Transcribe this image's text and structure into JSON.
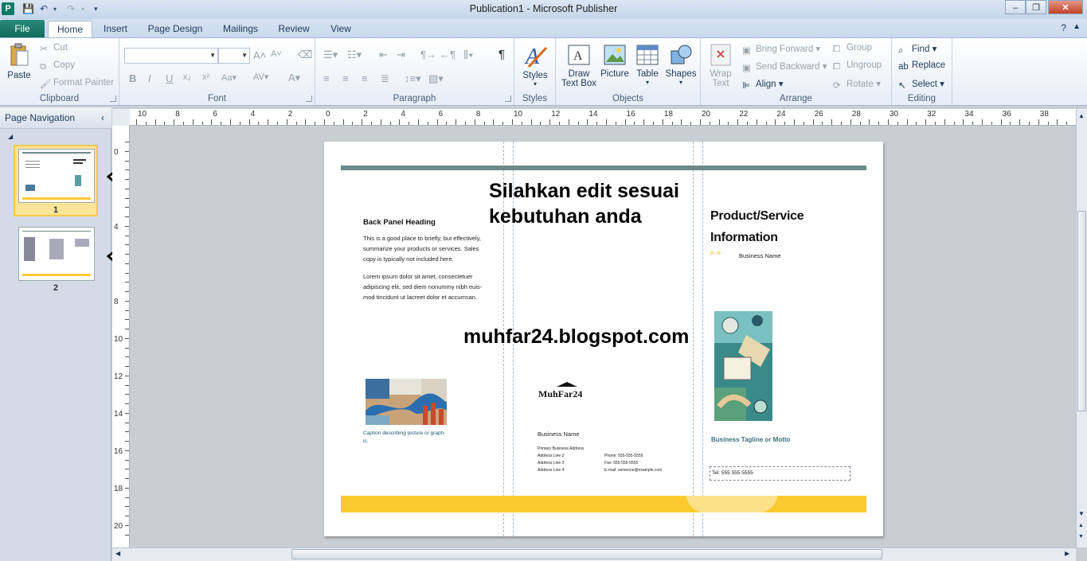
{
  "window": {
    "title": "Publication1  -  Microsoft Publisher",
    "app_letter": "P",
    "minimize": "–",
    "maximize": "❐",
    "close": "✕"
  },
  "tabs": {
    "file": "File",
    "items": [
      "Home",
      "Insert",
      "Page Design",
      "Mailings",
      "Review",
      "View"
    ],
    "active": "Home"
  },
  "ribbon": {
    "clipboard": {
      "label": "Clipboard",
      "paste": "Paste",
      "cut": "Cut",
      "copy": "Copy",
      "format_painter": "Format Painter"
    },
    "font": {
      "label": "Font"
    },
    "paragraph": {
      "label": "Paragraph"
    },
    "styles": {
      "label": "Styles",
      "button": "Styles"
    },
    "objects": {
      "label": "Objects",
      "draw_text_box_1": "Draw",
      "draw_text_box_2": "Text Box",
      "picture": "Picture",
      "table": "Table",
      "shapes": "Shapes"
    },
    "arrange": {
      "label": "Arrange",
      "wrap_1": "Wrap",
      "wrap_2": "Text",
      "bring_forward": "Bring Forward",
      "send_backward": "Send Backward",
      "align": "Align",
      "group": "Group",
      "ungroup": "Ungroup",
      "rotate": "Rotate"
    },
    "editing": {
      "label": "Editing",
      "find": "Find",
      "replace": "Replace",
      "select": "Select"
    }
  },
  "nav": {
    "title": "Page Navigation",
    "pages": [
      "1",
      "2"
    ]
  },
  "ruler": {
    "h_labels": [
      "10",
      "8",
      "6",
      "4",
      "2",
      "0",
      "2",
      "4",
      "6",
      "8",
      "10",
      "12",
      "14",
      "16",
      "18",
      "20",
      "22",
      "24",
      "26",
      "28",
      "30",
      "32",
      "34",
      "36",
      "38"
    ],
    "v_labels": [
      "0",
      "4",
      "8",
      "10",
      "12",
      "14",
      "16",
      "18",
      "20"
    ]
  },
  "doc": {
    "overlay_1": "Silahkan edit sesuai",
    "overlay_2": "kebutuhan anda",
    "watermark_url": "muhfar24.blogspot.com",
    "back_heading": "Back Panel Heading",
    "back_p1_1": "This is a good place to briefly, but effectively,",
    "back_p1_2": "summarize your products or services. Sales",
    "back_p1_3": "copy is typically not included here.",
    "back_p2_1": "Lorem ipsum dolor sit amet, consectetuer",
    "back_p2_2": "adipiscing elit, sed diem nonummy nibh euis-",
    "back_p2_3": "mod tincidunt ut lacreet dolor et accumsan.",
    "caption_1": "Caption describing picture or graph-",
    "caption_2": "ic.",
    "logo": "MuhFar24",
    "business_name": "Business Name",
    "addr_1": "Primary Business Address",
    "addr_2": "Address Line 2",
    "addr_3": "Address Line 3",
    "addr_4": "Address Line 4",
    "phone": "Phone: 555-555-5555",
    "fax": "Fax: 555-555-5555",
    "email": "E-mail: someone@example.com",
    "product_1": "Product/Service",
    "product_2": "Information",
    "product_business": "Business Name",
    "tagline": "Business Tagline or Motto",
    "tel": "Tel: 555 555 5555",
    "colors": {
      "teal_bar": "#6c8a8a",
      "yellow_bar": "#fbca2f",
      "accent": "#f2c230"
    }
  }
}
